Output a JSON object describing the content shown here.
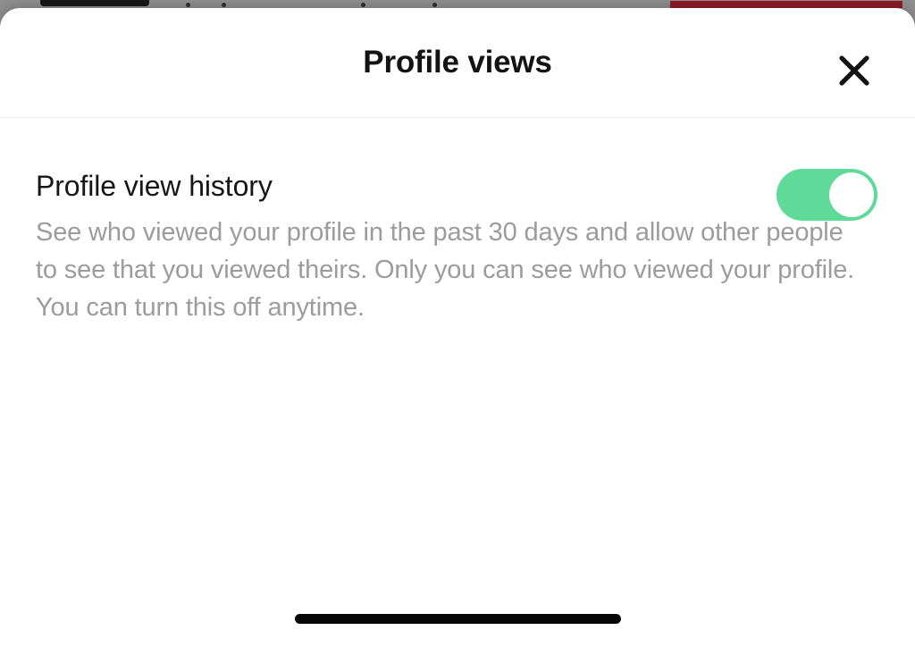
{
  "background": {
    "status_bar_dark_label": "status-bar-pill",
    "accent_color": "#8c1b27",
    "surface_color": "#8d8d8d"
  },
  "sheet": {
    "header": {
      "title": "Profile views",
      "close_icon": "close-icon",
      "close_label": "Close"
    },
    "setting": {
      "title": "Profile view history",
      "description": "See who viewed your profile in the past 30 days and allow other people to see that you viewed theirs. Only you can see who viewed your profile. You can turn this off anytime.",
      "toggle": {
        "state": "on",
        "on_color": "#5fda99",
        "knob_color": "#ffffff"
      }
    }
  },
  "system": {
    "home_indicator": "home-indicator"
  }
}
